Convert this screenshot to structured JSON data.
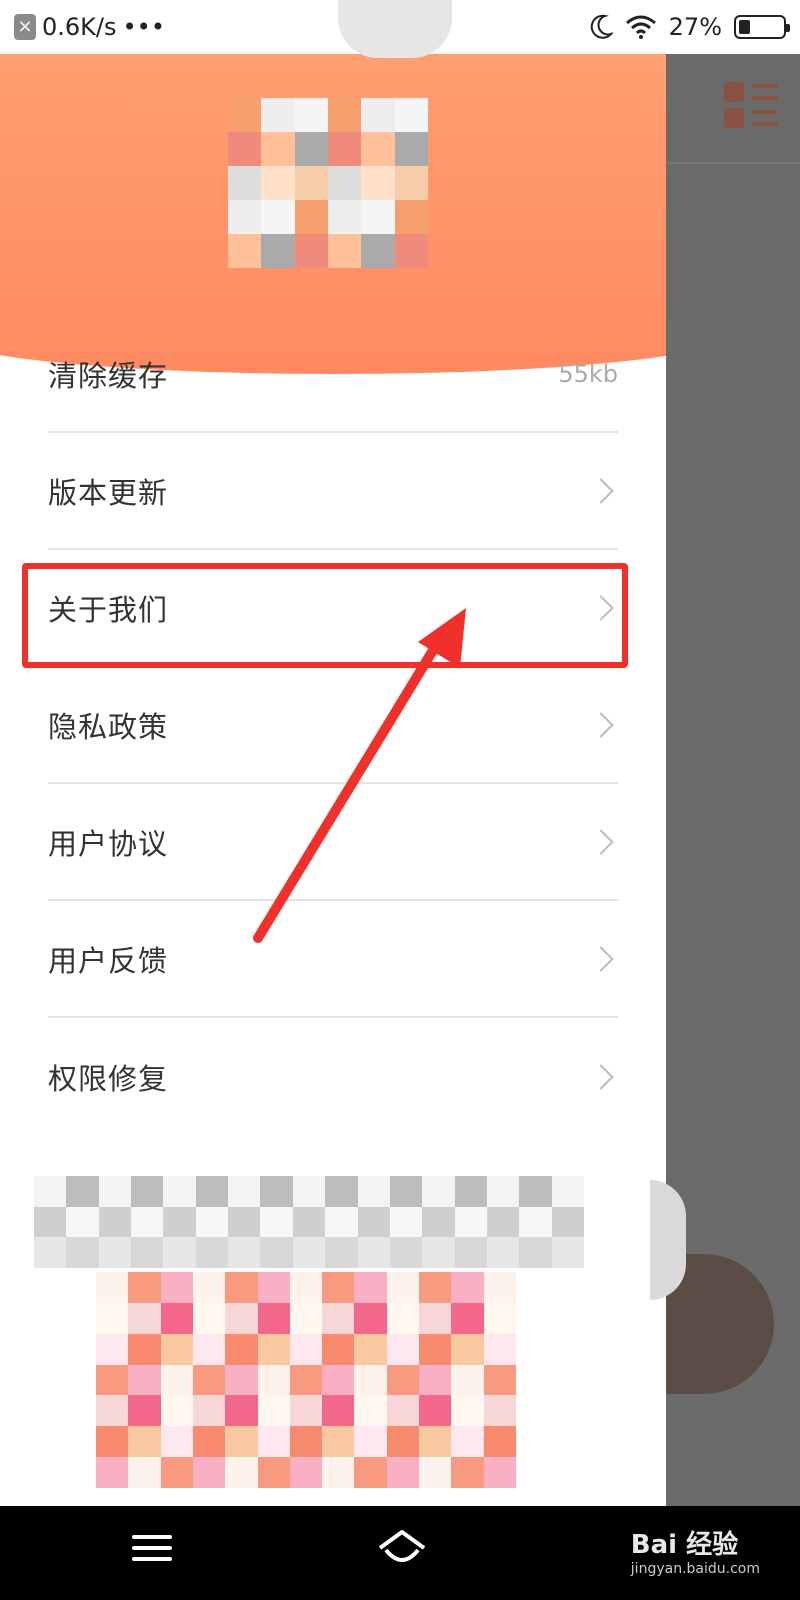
{
  "status_bar": {
    "speed": "0.6K/s",
    "more": "•••",
    "battery_percent": "27%",
    "battery_level": 0.27
  },
  "menu": {
    "items": [
      {
        "label": "清除缓存",
        "value": "55kb"
      },
      {
        "label": "版本更新"
      },
      {
        "label": "关于我们"
      },
      {
        "label": "隐私政策"
      },
      {
        "label": "用户协议"
      },
      {
        "label": "用户反馈"
      },
      {
        "label": "权限修复"
      }
    ]
  },
  "annotation": {
    "highlight_color": "#f0302a"
  },
  "colors": {
    "header_accent": "#ff8a62"
  },
  "watermark": {
    "brand": "Bai 经验",
    "url": "jingyan.baidu.com"
  }
}
